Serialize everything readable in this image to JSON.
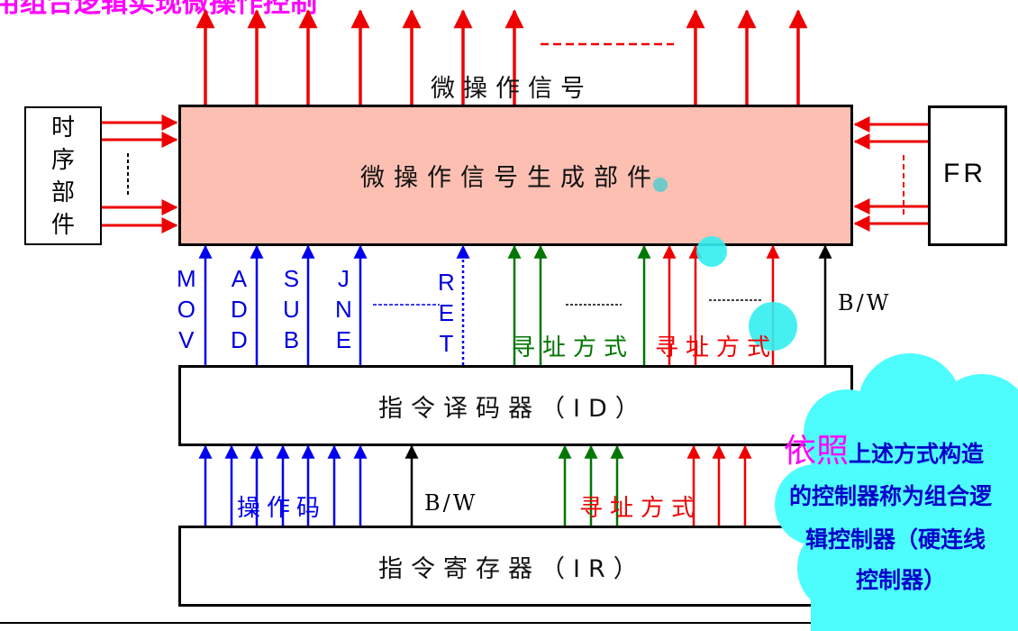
{
  "top_title": "用组合逻辑实现微操作控制",
  "micro_signals_label": "微操作信号",
  "generator_label": "微操作信号生成部件",
  "timing_label": [
    "时",
    "序",
    "部",
    "件"
  ],
  "fr_label": "FR",
  "opcodes": [
    {
      "letters": [
        "M",
        "O",
        "V"
      ]
    },
    {
      "letters": [
        "A",
        "D",
        "D"
      ]
    },
    {
      "letters": [
        "S",
        "U",
        "B"
      ]
    },
    {
      "letters": [
        "J",
        "N",
        "E"
      ]
    },
    {
      "letters": [
        "R",
        "E",
        "T"
      ]
    }
  ],
  "addressing_mode_green": "寻址方式",
  "addressing_mode_red": "寻址方式",
  "bw_upper": "B/W",
  "decoder_label": "指令译码器（ID）",
  "opcode_label": "操作码",
  "bw_lower": "B/W",
  "addressing_mode_lower": "寻址方式",
  "register_label": "指令寄存器（IR）",
  "cloud_note": {
    "highlight": "依照",
    "line1_rest": "上述方式构造",
    "line2": "的控制器称为组合逻",
    "line3": "辑控制器（硬连线",
    "line4": "控制器）"
  },
  "colors": {
    "red": "#ee0000",
    "blue": "#0000ee",
    "green": "#007700",
    "generator_fill": "#fcbfb2",
    "cloud": "#4dfdfd",
    "magenta": "#ff00ff"
  }
}
